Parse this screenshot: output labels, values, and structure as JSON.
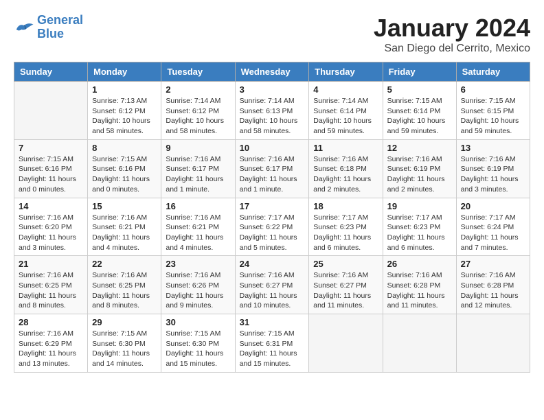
{
  "logo": {
    "line1": "General",
    "line2": "Blue"
  },
  "title": "January 2024",
  "location": "San Diego del Cerrito, Mexico",
  "days_of_week": [
    "Sunday",
    "Monday",
    "Tuesday",
    "Wednesday",
    "Thursday",
    "Friday",
    "Saturday"
  ],
  "weeks": [
    [
      {
        "num": "",
        "info": ""
      },
      {
        "num": "1",
        "info": "Sunrise: 7:13 AM\nSunset: 6:12 PM\nDaylight: 10 hours\nand 58 minutes."
      },
      {
        "num": "2",
        "info": "Sunrise: 7:14 AM\nSunset: 6:12 PM\nDaylight: 10 hours\nand 58 minutes."
      },
      {
        "num": "3",
        "info": "Sunrise: 7:14 AM\nSunset: 6:13 PM\nDaylight: 10 hours\nand 58 minutes."
      },
      {
        "num": "4",
        "info": "Sunrise: 7:14 AM\nSunset: 6:14 PM\nDaylight: 10 hours\nand 59 minutes."
      },
      {
        "num": "5",
        "info": "Sunrise: 7:15 AM\nSunset: 6:14 PM\nDaylight: 10 hours\nand 59 minutes."
      },
      {
        "num": "6",
        "info": "Sunrise: 7:15 AM\nSunset: 6:15 PM\nDaylight: 10 hours\nand 59 minutes."
      }
    ],
    [
      {
        "num": "7",
        "info": "Sunrise: 7:15 AM\nSunset: 6:16 PM\nDaylight: 11 hours\nand 0 minutes."
      },
      {
        "num": "8",
        "info": "Sunrise: 7:15 AM\nSunset: 6:16 PM\nDaylight: 11 hours\nand 0 minutes."
      },
      {
        "num": "9",
        "info": "Sunrise: 7:16 AM\nSunset: 6:17 PM\nDaylight: 11 hours\nand 1 minute."
      },
      {
        "num": "10",
        "info": "Sunrise: 7:16 AM\nSunset: 6:17 PM\nDaylight: 11 hours\nand 1 minute."
      },
      {
        "num": "11",
        "info": "Sunrise: 7:16 AM\nSunset: 6:18 PM\nDaylight: 11 hours\nand 2 minutes."
      },
      {
        "num": "12",
        "info": "Sunrise: 7:16 AM\nSunset: 6:19 PM\nDaylight: 11 hours\nand 2 minutes."
      },
      {
        "num": "13",
        "info": "Sunrise: 7:16 AM\nSunset: 6:19 PM\nDaylight: 11 hours\nand 3 minutes."
      }
    ],
    [
      {
        "num": "14",
        "info": "Sunrise: 7:16 AM\nSunset: 6:20 PM\nDaylight: 11 hours\nand 3 minutes."
      },
      {
        "num": "15",
        "info": "Sunrise: 7:16 AM\nSunset: 6:21 PM\nDaylight: 11 hours\nand 4 minutes."
      },
      {
        "num": "16",
        "info": "Sunrise: 7:16 AM\nSunset: 6:21 PM\nDaylight: 11 hours\nand 4 minutes."
      },
      {
        "num": "17",
        "info": "Sunrise: 7:17 AM\nSunset: 6:22 PM\nDaylight: 11 hours\nand 5 minutes."
      },
      {
        "num": "18",
        "info": "Sunrise: 7:17 AM\nSunset: 6:23 PM\nDaylight: 11 hours\nand 6 minutes."
      },
      {
        "num": "19",
        "info": "Sunrise: 7:17 AM\nSunset: 6:23 PM\nDaylight: 11 hours\nand 6 minutes."
      },
      {
        "num": "20",
        "info": "Sunrise: 7:17 AM\nSunset: 6:24 PM\nDaylight: 11 hours\nand 7 minutes."
      }
    ],
    [
      {
        "num": "21",
        "info": "Sunrise: 7:16 AM\nSunset: 6:25 PM\nDaylight: 11 hours\nand 8 minutes."
      },
      {
        "num": "22",
        "info": "Sunrise: 7:16 AM\nSunset: 6:25 PM\nDaylight: 11 hours\nand 8 minutes."
      },
      {
        "num": "23",
        "info": "Sunrise: 7:16 AM\nSunset: 6:26 PM\nDaylight: 11 hours\nand 9 minutes."
      },
      {
        "num": "24",
        "info": "Sunrise: 7:16 AM\nSunset: 6:27 PM\nDaylight: 11 hours\nand 10 minutes."
      },
      {
        "num": "25",
        "info": "Sunrise: 7:16 AM\nSunset: 6:27 PM\nDaylight: 11 hours\nand 11 minutes."
      },
      {
        "num": "26",
        "info": "Sunrise: 7:16 AM\nSunset: 6:28 PM\nDaylight: 11 hours\nand 11 minutes."
      },
      {
        "num": "27",
        "info": "Sunrise: 7:16 AM\nSunset: 6:28 PM\nDaylight: 11 hours\nand 12 minutes."
      }
    ],
    [
      {
        "num": "28",
        "info": "Sunrise: 7:16 AM\nSunset: 6:29 PM\nDaylight: 11 hours\nand 13 minutes."
      },
      {
        "num": "29",
        "info": "Sunrise: 7:15 AM\nSunset: 6:30 PM\nDaylight: 11 hours\nand 14 minutes."
      },
      {
        "num": "30",
        "info": "Sunrise: 7:15 AM\nSunset: 6:30 PM\nDaylight: 11 hours\nand 15 minutes."
      },
      {
        "num": "31",
        "info": "Sunrise: 7:15 AM\nSunset: 6:31 PM\nDaylight: 11 hours\nand 15 minutes."
      },
      {
        "num": "",
        "info": ""
      },
      {
        "num": "",
        "info": ""
      },
      {
        "num": "",
        "info": ""
      }
    ]
  ]
}
